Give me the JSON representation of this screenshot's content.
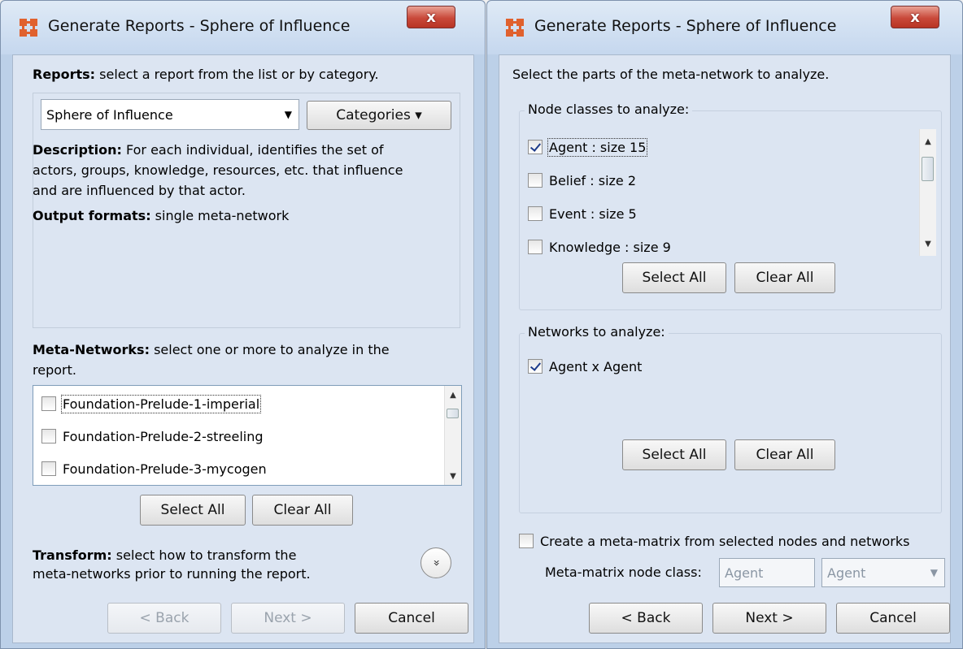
{
  "window_title": "Generate Reports - Sphere of Influence",
  "close_symbol": "x",
  "left": {
    "reports_label_bold": "Reports:",
    "reports_label_rest": " select a report from the list or by category.",
    "report_select_value": "Sphere of Influence",
    "categories_button": "Categories ▾",
    "description_bold": "Description:",
    "description_text": " For each individual, identifies the set of",
    "description_line2": "actors, groups, knowledge, resources, etc. that influence",
    "description_line3": "and are influenced by that actor.",
    "output_bold": "Output formats:",
    "output_text": " single meta-network",
    "metanetworks_bold": "Meta-Networks:",
    "metanetworks_rest": " select one or more to analyze in the",
    "metanetworks_line2": "report.",
    "metanetworks": [
      {
        "label": "Foundation-Prelude-1-imperial",
        "checked": false
      },
      {
        "label": "Foundation-Prelude-2-streeling",
        "checked": false
      },
      {
        "label": "Foundation-Prelude-3-mycogen",
        "checked": false
      }
    ],
    "select_all": "Select All",
    "clear_all": "Clear All",
    "transform_bold": "Transform:",
    "transform_rest": " select how to transform the",
    "transform_line2": "meta-networks prior to running the report.",
    "expand_symbol": "»",
    "back": "< Back",
    "next": "Next >",
    "cancel": "Cancel"
  },
  "right": {
    "intro": "Select the parts of the meta-network to analyze.",
    "node_classes_title": "Node classes to analyze:",
    "node_classes": [
      {
        "label": "Agent : size 15",
        "checked": true
      },
      {
        "label": "Belief : size 2",
        "checked": false
      },
      {
        "label": "Event : size 5",
        "checked": false
      },
      {
        "label": "Knowledge : size 9",
        "checked": false
      }
    ],
    "networks_title": "Networks to analyze:",
    "networks": [
      {
        "label": "Agent x Agent",
        "checked": true
      }
    ],
    "select_all": "Select All",
    "clear_all": "Clear All",
    "meta_matrix_checkbox": "Create a meta-matrix from selected nodes and networks",
    "meta_matrix_node_class_label": "Meta-matrix node class:",
    "meta_matrix_field_value": "Agent",
    "meta_matrix_select_value": "Agent",
    "back": "< Back",
    "next": "Next >",
    "cancel": "Cancel"
  }
}
